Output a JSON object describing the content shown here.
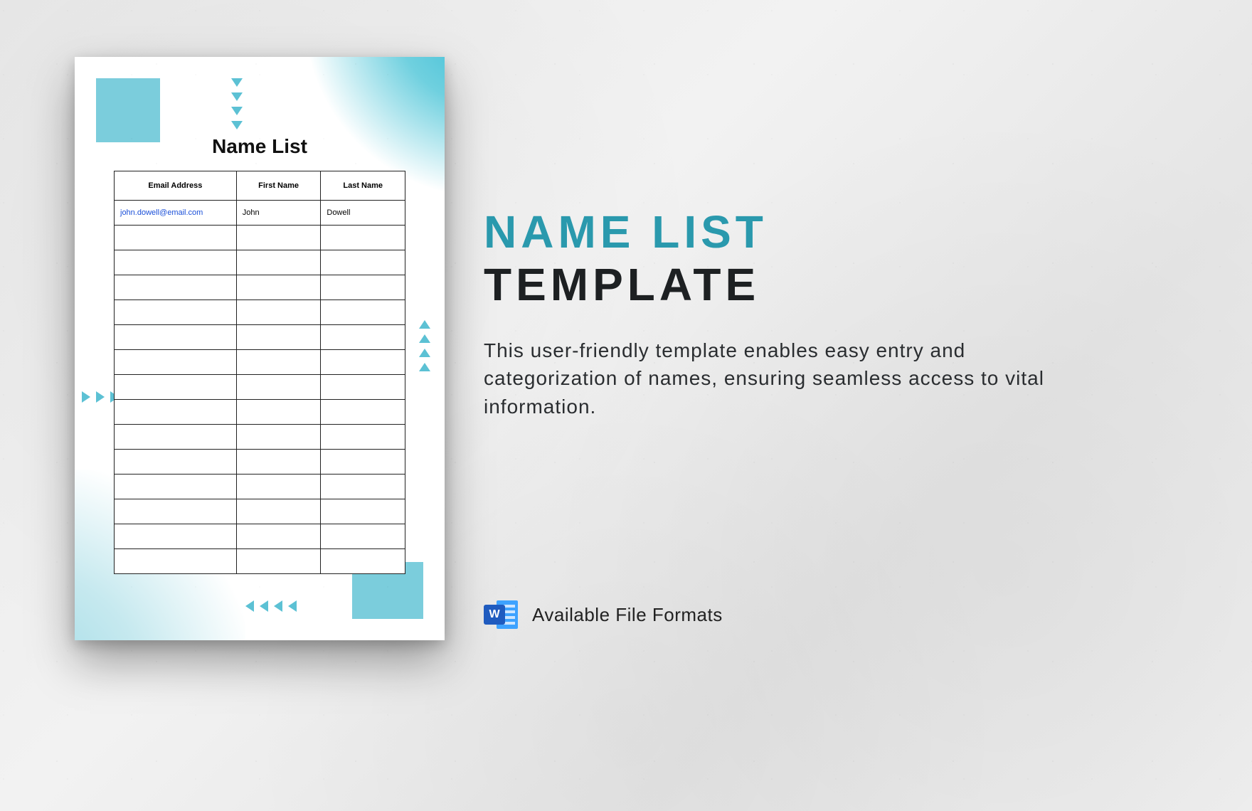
{
  "document": {
    "title": "Name List",
    "columns": [
      "Email Address",
      "First Name",
      "Last Name"
    ],
    "rows": [
      {
        "email": "john.dowell@email.com",
        "first": "John",
        "last": "Dowell"
      }
    ],
    "empty_row_count": 14
  },
  "promo": {
    "headline_line1": "NAME LIST",
    "headline_line2": "TEMPLATE",
    "description": "This user-friendly template enables easy entry and categorization of names, ensuring seamless access to vital information."
  },
  "formats": {
    "label": "Available File Formats",
    "icons": [
      "word"
    ]
  },
  "colors": {
    "accent_teal": "#2a99ad",
    "page_teal": "#5cc1d4"
  }
}
